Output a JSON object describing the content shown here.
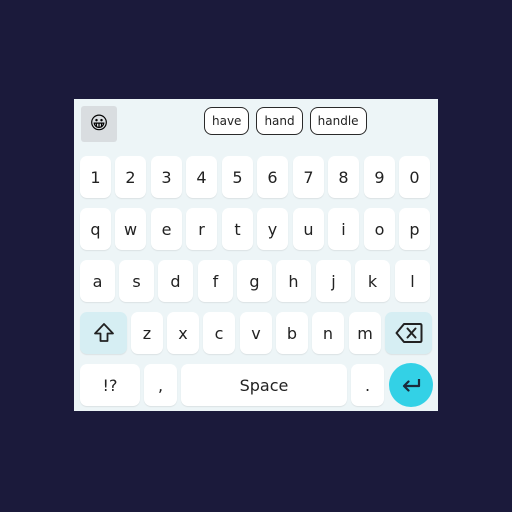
{
  "keyboard": {
    "emoji_icon": "😀",
    "suggestions": [
      "have",
      "hand",
      "handle"
    ],
    "rows": {
      "numbers": [
        "1",
        "2",
        "3",
        "4",
        "5",
        "6",
        "7",
        "8",
        "9",
        "0"
      ],
      "top": [
        "q",
        "w",
        "e",
        "r",
        "t",
        "y",
        "u",
        "i",
        "o",
        "p"
      ],
      "home": [
        "a",
        "s",
        "d",
        "f",
        "g",
        "h",
        "j",
        "k",
        "l"
      ],
      "bottom": [
        "z",
        "x",
        "c",
        "v",
        "b",
        "n",
        "m"
      ]
    },
    "shift_icon": "shift-arrow-icon",
    "backspace_icon": "backspace-icon",
    "enter_icon": "enter-arrow-icon",
    "symbols_label": "!?",
    "comma_label": ",",
    "space_label": "Space",
    "period_label": ".",
    "colors": {
      "background": "#1b1a3b",
      "keyboard": "#edf5f7",
      "key": "#ffffff",
      "modifier_key": "#d6eef3",
      "enter": "#33d1e6"
    }
  }
}
